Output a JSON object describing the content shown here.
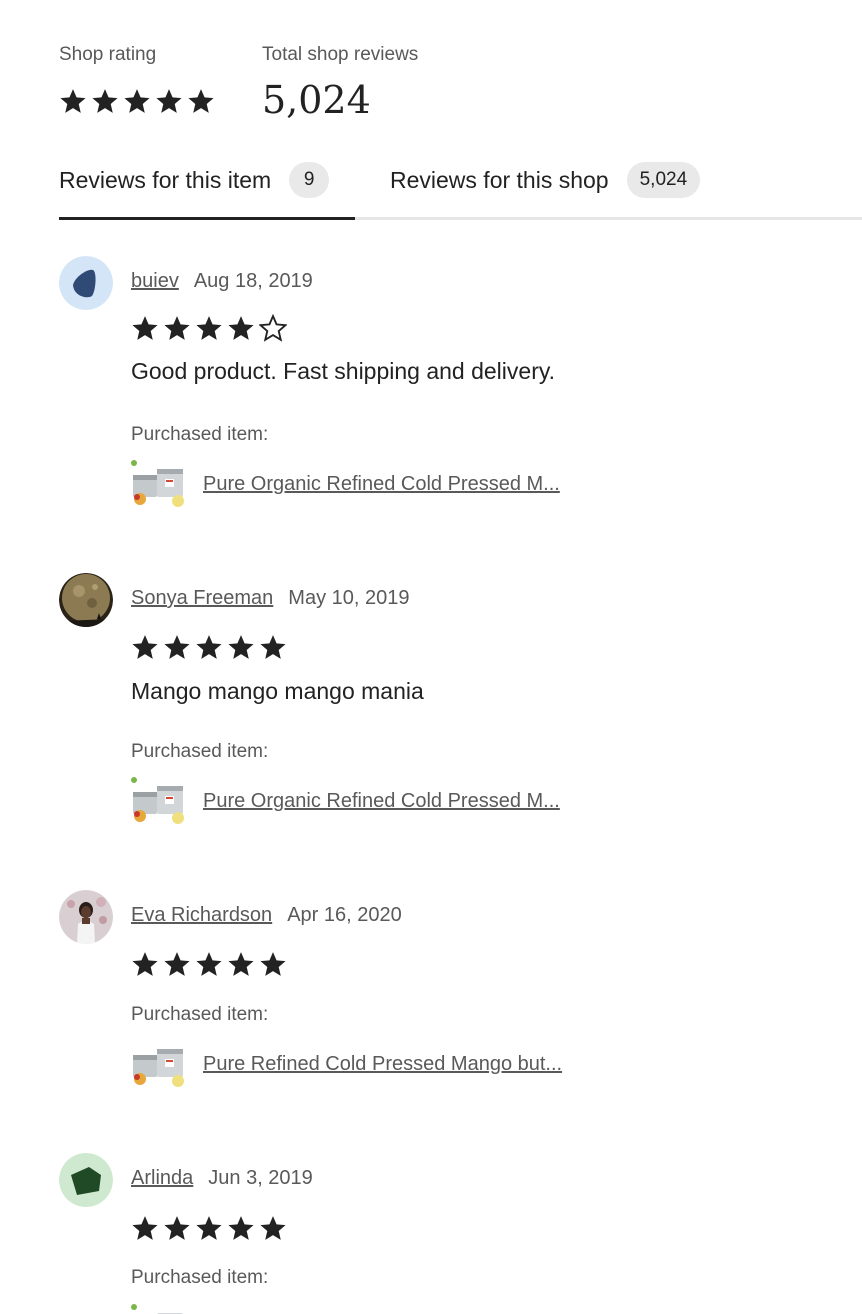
{
  "summary": {
    "shop_rating_label": "Shop rating",
    "shop_rating_stars": 5,
    "total_reviews_label": "Total shop reviews",
    "total_reviews_value": "5,024"
  },
  "tabs": [
    {
      "label": "Reviews for this item",
      "count": "9",
      "active": true
    },
    {
      "label": "Reviews for this shop",
      "count": "5,024",
      "active": false
    }
  ],
  "purchased_label": "Purchased item:",
  "reviews": [
    {
      "reviewer": "buiev",
      "date": "Aug 18, 2019",
      "rating": 4,
      "text": "Good product. Fast shipping and delivery.",
      "item": "Pure Organic Refined Cold Pressed M...",
      "avatar": "blue-shape"
    },
    {
      "reviewer": "Sonya Freeman",
      "date": "May 10, 2019",
      "rating": 5,
      "text": "Mango mango mango mania",
      "item": "Pure Organic Refined Cold Pressed M...",
      "avatar": "moon-photo"
    },
    {
      "reviewer": "Eva Richardson",
      "date": "Apr 16, 2020",
      "rating": 5,
      "text": "",
      "item": "Pure Refined Cold Pressed Mango but...",
      "avatar": "person-photo"
    },
    {
      "reviewer": "Arlinda",
      "date": "Jun 3, 2019",
      "rating": 5,
      "text": "",
      "item": "",
      "avatar": "green-shape"
    }
  ],
  "colors": {
    "star": "#222222",
    "text_muted": "#595959",
    "tab_active_border": "#222222",
    "badge_bg": "#e9e9e9"
  }
}
